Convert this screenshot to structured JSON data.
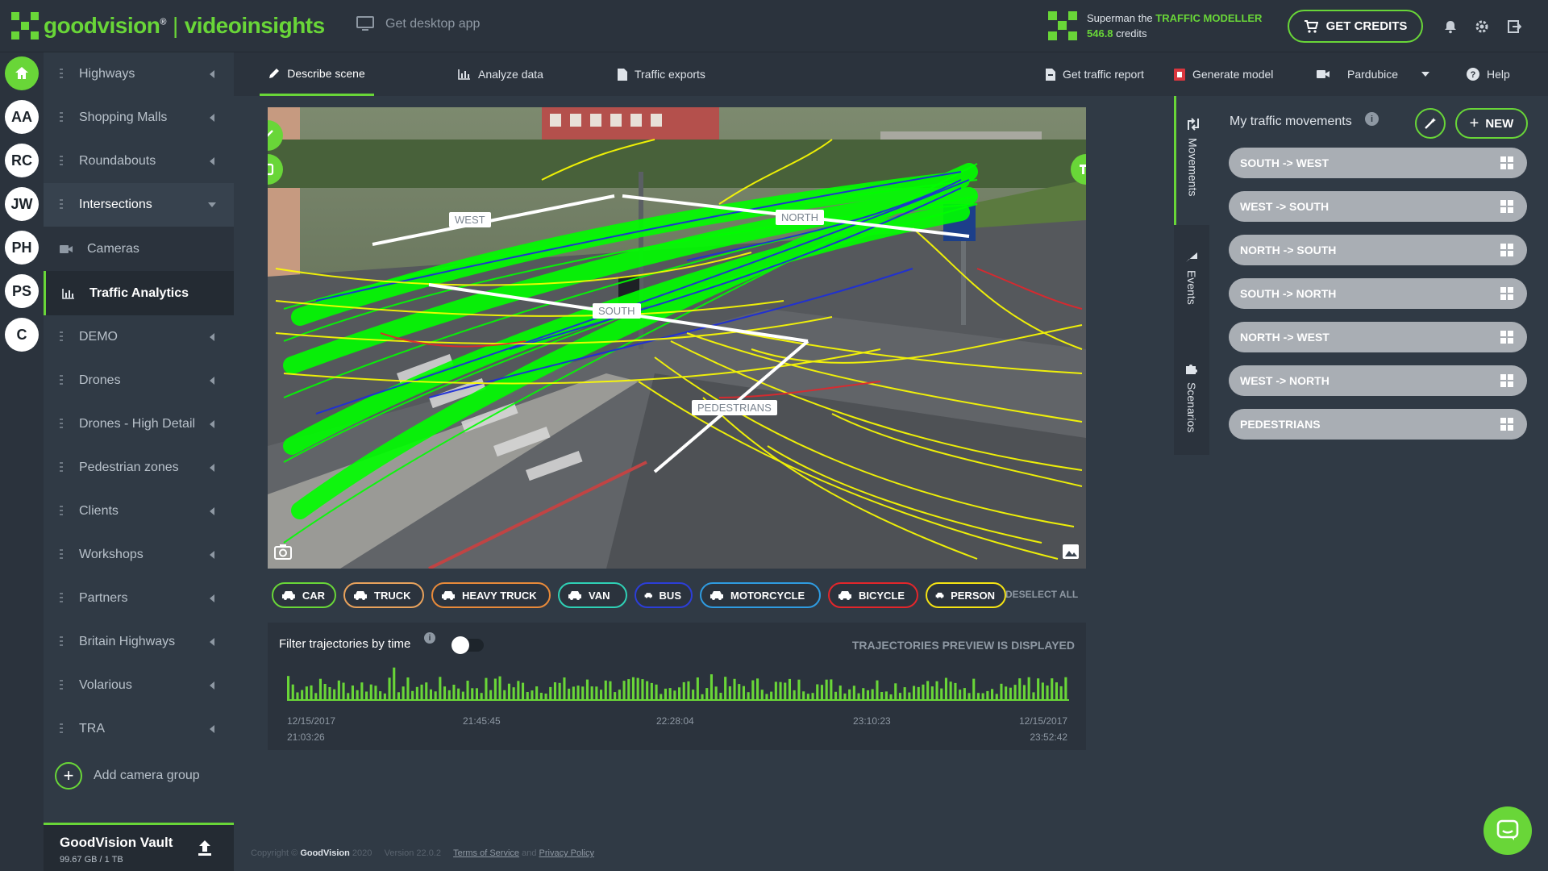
{
  "brand": {
    "name": "goodvision",
    "trademark": "®",
    "separator": "|",
    "product": "videoinsights",
    "desktop_app_label": "Get desktop app"
  },
  "user": {
    "name_prefix": "Superman the",
    "role": "TRAFFIC MODELLER",
    "credits_value": "546.8",
    "credits_label": "credits"
  },
  "header_actions": {
    "get_credits": "GET CREDITS"
  },
  "avatars": [
    "AA",
    "RC",
    "JW",
    "PH",
    "PS",
    "C"
  ],
  "sidebar": {
    "groups_top": [
      "Highways",
      "Shopping Malls",
      "Roundabouts"
    ],
    "open_group": "Intersections",
    "sub_items": [
      "Cameras",
      "Traffic Analytics"
    ],
    "groups_bottom": [
      "DEMO",
      "Drones",
      "Drones - High Detail",
      "Pedestrian zones",
      "Clients",
      "Workshops",
      "Partners",
      "Britain Highways",
      "Volarious",
      "TRA"
    ],
    "add_group": "Add camera group",
    "vault_title": "GoodVision Vault",
    "vault_size": "99.67 GB / 1 TB"
  },
  "tabs": {
    "describe": "Describe scene",
    "analyze": "Analyze data",
    "exports": "Traffic exports",
    "report": "Get traffic report",
    "model": "Generate model",
    "city": "Pardubice",
    "help": "Help"
  },
  "scene": {
    "zones": [
      "WEST",
      "NORTH",
      "SOUTH",
      "PEDESTRIANS"
    ],
    "colors": {
      "car": "#00ff00",
      "person": "#ffff00",
      "bus": "#1f2fd6",
      "bicycle": "#e3262b"
    }
  },
  "classes": [
    {
      "label": "CAR",
      "color": "#69d638"
    },
    {
      "label": "TRUCK",
      "color": "#e8a25c"
    },
    {
      "label": "HEAVY TRUCK",
      "color": "#e88a3a"
    },
    {
      "label": "VAN",
      "color": "#2fd0b5"
    },
    {
      "label": "BUS",
      "color": "#2c3ed8"
    },
    {
      "label": "MOTORCYCLE",
      "color": "#2f9be0"
    },
    {
      "label": "BICYCLE",
      "color": "#e3262b"
    },
    {
      "label": "PERSON",
      "color": "#f5e313"
    }
  ],
  "deselect_all": "DESELECT ALL",
  "timeline": {
    "filter_label": "Filter trajectories by time",
    "info": "i",
    "preview_label": "TRAJECTORIES PREVIEW IS DISPLAYED",
    "ticks": [
      {
        "line1": "12/15/2017",
        "line2": "21:03:26"
      },
      {
        "line1": "21:45:45",
        "line2": ""
      },
      {
        "line1": "22:28:04",
        "line2": ""
      },
      {
        "line1": "23:10:23",
        "line2": ""
      },
      {
        "line1": "12/15/2017",
        "line2": "23:52:42"
      }
    ]
  },
  "side_tabs": [
    "Movements",
    "Events",
    "Scenarios"
  ],
  "movements": {
    "title": "My traffic movements",
    "info": "i",
    "new_label": "NEW",
    "new_plus": "+",
    "items": [
      "SOUTH -> WEST",
      "WEST -> SOUTH",
      "NORTH -> SOUTH",
      "SOUTH -> NORTH",
      "NORTH -> WEST",
      "WEST -> NORTH",
      "PEDESTRIANS"
    ]
  },
  "footer": {
    "copyright": "Copyright ©",
    "company": "GoodVision",
    "year": "2020",
    "version": "Version 22.0.2",
    "terms": "Terms of Service",
    "and": "and",
    "privacy": "Privacy Policy"
  }
}
